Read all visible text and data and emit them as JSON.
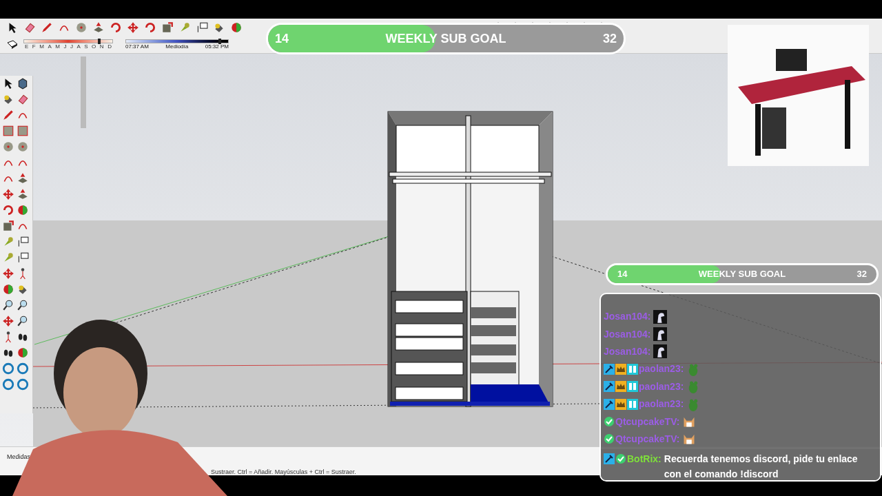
{
  "toolbar": {
    "shadow_months": [
      "E",
      "F",
      "M",
      "A",
      "M",
      "J",
      "J",
      "A",
      "S",
      "O",
      "N",
      "D"
    ],
    "month_slider": {
      "level": 0.85
    },
    "shadow_times": [
      "07:37 AM",
      "Mediodía",
      "05:32 PM"
    ],
    "time_slider": {
      "level": 0.92
    }
  },
  "panel_label": "Medidas",
  "status_bar": {
    "text": "Sustraer. Ctrl = Añadir. Mayúsculas + Ctrl = Sustraer."
  },
  "sub_goals": [
    {
      "current": "14",
      "title": "WEEKLY SUB GOAL",
      "target": "32",
      "level": 0.47
    },
    {
      "current": "14",
      "title": "WEEKLY SUB GOAL",
      "target": "32",
      "level": 0.42
    }
  ],
  "chat": {
    "messages": [
      {
        "user": "Josan104:",
        "color": "#9b5de5",
        "emote": {
          "kind": "dino"
        }
      },
      {
        "user": "Josan104:",
        "color": "#9b5de5",
        "emote": {
          "kind": "dino"
        }
      },
      {
        "user": "Josan104:",
        "color": "#9b5de5",
        "emote": {
          "kind": "dino"
        }
      },
      {
        "badges": [
          {
            "kind": "mod"
          },
          {
            "kind": "sub"
          },
          {
            "kind": "gg"
          }
        ],
        "user": "paolan23:",
        "color": "#9b5de5",
        "emote": {
          "kind": "frog"
        }
      },
      {
        "badges": [
          {
            "kind": "mod"
          },
          {
            "kind": "sub"
          },
          {
            "kind": "gg"
          }
        ],
        "user": "paolan23:",
        "color": "#9b5de5",
        "emote": {
          "kind": "frog"
        }
      },
      {
        "badges": [
          {
            "kind": "mod"
          },
          {
            "kind": "sub"
          },
          {
            "kind": "gg"
          }
        ],
        "user": "paolan23:",
        "color": "#9b5de5",
        "emote": {
          "kind": "frog"
        }
      },
      {
        "badges": [
          {
            "kind": "verified"
          }
        ],
        "user": "QtcupcakeTV:",
        "color": "#9b5de5",
        "emote": {
          "kind": "dog"
        }
      },
      {
        "badges": [
          {
            "kind": "verified"
          }
        ],
        "user": "QtcupcakeTV:",
        "color": "#9b5de5",
        "emote": {
          "kind": "dog"
        }
      },
      {
        "badges": [
          {
            "kind": "mod"
          },
          {
            "kind": "verified"
          }
        ],
        "user": "BotRix:",
        "color": "#7ee03a",
        "text": "Recuerda tenemos discord, pide tu enlace con el comando !discord"
      }
    ]
  }
}
